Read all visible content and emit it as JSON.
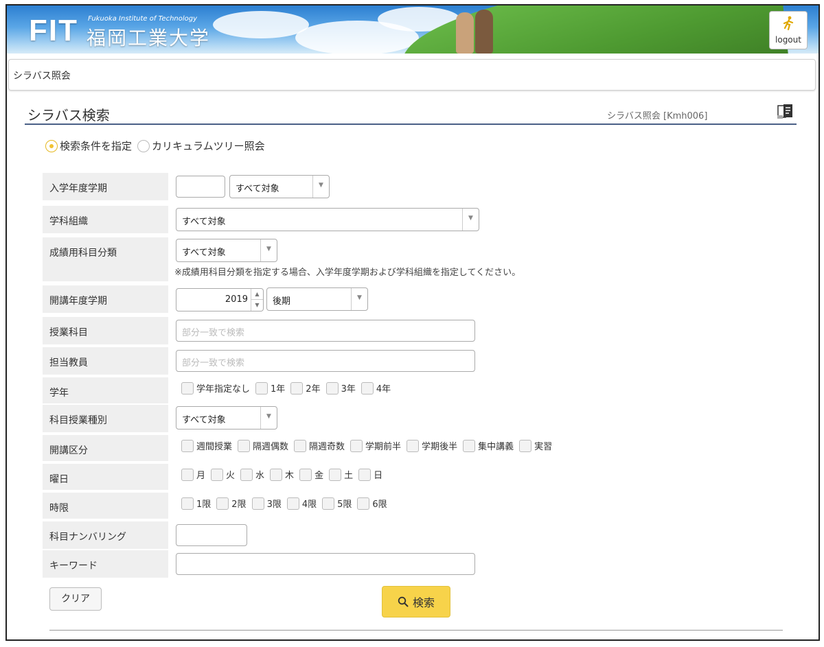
{
  "header": {
    "logo_text": "FIT",
    "logo_en": "Fukuoka Institute of Technology",
    "logo_ja": "福岡工業大学",
    "logout_label": "logout"
  },
  "breadcrumb": "シラバス照会",
  "section": {
    "title": "シラバス検索",
    "screen_id": "シラバス照会 [Kmh006]"
  },
  "mode": {
    "options": [
      "検索条件を指定",
      "カリキュラムツリー照会"
    ],
    "selected": 0
  },
  "form": {
    "enroll_term": {
      "label": "入学年度学期",
      "year_value": "",
      "select_value": "すべて対象"
    },
    "department": {
      "label": "学科組織",
      "select_value": "すべて対象"
    },
    "grade_category": {
      "label": "成績用科目分類",
      "select_value": "すべて対象",
      "note": "※成績用科目分類を指定する場合、入学年度学期および学科組織を指定してください。"
    },
    "open_term": {
      "label": "開講年度学期",
      "year_value": "2019",
      "term_value": "後期"
    },
    "course": {
      "label": "授業科目",
      "placeholder": "部分一致で検索"
    },
    "teacher": {
      "label": "担当教員",
      "placeholder": "部分一致で検索"
    },
    "grade": {
      "label": "学年",
      "options": [
        "学年指定なし",
        "1年",
        "2年",
        "3年",
        "4年"
      ]
    },
    "class_type": {
      "label": "科目授業種別",
      "select_value": "すべて対象"
    },
    "open_division": {
      "label": "開講区分",
      "options": [
        "週間授業",
        "隔週偶数",
        "隔週奇数",
        "学期前半",
        "学期後半",
        "集中講義",
        "実習"
      ]
    },
    "weekday": {
      "label": "曜日",
      "options": [
        "月",
        "火",
        "水",
        "木",
        "金",
        "土",
        "日"
      ]
    },
    "period": {
      "label": "時限",
      "options": [
        "1限",
        "2限",
        "3限",
        "4限",
        "5限",
        "6限"
      ]
    },
    "numbering": {
      "label": "科目ナンバリング",
      "value": ""
    },
    "keyword": {
      "label": "キーワード",
      "value": ""
    }
  },
  "buttons": {
    "clear": "クリア",
    "search": "検索"
  }
}
